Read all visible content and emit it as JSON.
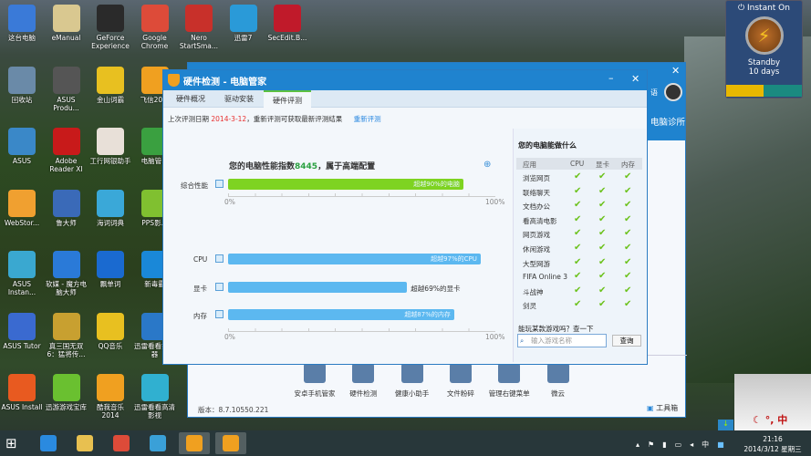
{
  "desktop_icons": [
    {
      "label": "这台电脑",
      "col": 0,
      "row": 0,
      "color": "#3a7ad8"
    },
    {
      "label": "eManual",
      "col": 1,
      "row": 0,
      "color": "#d9c890"
    },
    {
      "label": "GeForce Experience",
      "col": 2,
      "row": 0,
      "color": "#2a2a2a"
    },
    {
      "label": "Google Chrome",
      "col": 3,
      "row": 0,
      "color": "#dd4b39"
    },
    {
      "label": "Nero StartSma...",
      "col": 4,
      "row": 0,
      "color": "#c8302a"
    },
    {
      "label": "迅雷7",
      "col": 5,
      "row": 0,
      "color": "#2a9ad8"
    },
    {
      "label": "SecEdit.B...",
      "col": 6,
      "row": 0,
      "color": "#c01a2a"
    },
    {
      "label": "回收站",
      "col": 0,
      "row": 1,
      "color": "#6a8aa8"
    },
    {
      "label": "ASUS Produ...",
      "col": 1,
      "row": 1,
      "color": "#555"
    },
    {
      "label": "金山词霸",
      "col": 2,
      "row": 1,
      "color": "#e8c020"
    },
    {
      "label": "飞信20...",
      "col": 3,
      "row": 1,
      "color": "#f0a020"
    },
    {
      "label": "ASUS",
      "col": 0,
      "row": 2,
      "color": "#3a88c8"
    },
    {
      "label": "Adobe Reader XI",
      "col": 1,
      "row": 2,
      "color": "#c81a1a"
    },
    {
      "label": "工行网银助手",
      "col": 2,
      "row": 2,
      "color": "#e8e0d8"
    },
    {
      "label": "电脑管...",
      "col": 3,
      "row": 2,
      "color": "#3aa040"
    },
    {
      "label": "WebStor...",
      "col": 0,
      "row": 3,
      "color": "#f0a030"
    },
    {
      "label": "鲁大师",
      "col": 1,
      "row": 3,
      "color": "#3a6ab8"
    },
    {
      "label": "海词词典",
      "col": 2,
      "row": 3,
      "color": "#3aa8d8"
    },
    {
      "label": "PPS影...",
      "col": 3,
      "row": 3,
      "color": "#80c030"
    },
    {
      "label": "ASUS Instan...",
      "col": 0,
      "row": 4,
      "color": "#3aa8d0"
    },
    {
      "label": "软媒 - 魔方电脑大师",
      "col": 1,
      "row": 4,
      "color": "#2a7ad8"
    },
    {
      "label": "飘单词",
      "col": 2,
      "row": 4,
      "color": "#1a6ad0"
    },
    {
      "label": "新毒霸",
      "col": 3,
      "row": 4,
      "color": "#1a88d8"
    },
    {
      "label": "ASUS Tutor",
      "col": 0,
      "row": 5,
      "color": "#3a6ad0"
    },
    {
      "label": "真三国无双6：猛将传...",
      "col": 1,
      "row": 5,
      "color": "#c8a030"
    },
    {
      "label": "QQ音乐",
      "col": 2,
      "row": 5,
      "color": "#e8c020"
    },
    {
      "label": "迅雷看看播放器",
      "col": 3,
      "row": 5,
      "color": "#2a78c8"
    },
    {
      "label": "ASUS Install",
      "col": 0,
      "row": 6,
      "color": "#e85a20"
    },
    {
      "label": "迅游游戏宝库",
      "col": 1,
      "row": 6,
      "color": "#6ac030"
    },
    {
      "label": "酷我音乐2014",
      "col": 2,
      "row": 6,
      "color": "#f0a020"
    },
    {
      "label": "迅雷看看高清影视",
      "col": 3,
      "row": 6,
      "color": "#30b0d0"
    }
  ],
  "instant_on": {
    "title": "Instant On",
    "status": "Standby",
    "days": "10 days"
  },
  "back_window": {
    "right_text": "电脑诊所",
    "partial_text": "语",
    "version": "版本：8.7.10550.221",
    "toolbox": "工具箱",
    "tools": [
      "安卓手机管家",
      "硬件检测",
      "健康小助手",
      "文件粉碎",
      "管理右键菜单",
      "微云"
    ]
  },
  "window": {
    "title": "硬件检测 - 电脑管家",
    "tabs": [
      "硬件概况",
      "驱动安装",
      "硬件评测"
    ],
    "active_tab": 2,
    "date_prefix": "上次评测日期 ",
    "date": "2014-3-12",
    "date_suffix": "，重新评测可获取最新评测结果",
    "retest": "重新评测",
    "heading_prefix": "您的电脑性能指数",
    "score": "8445",
    "heading_suffix": "，属于高端配置",
    "axis_min": "0%",
    "axis_max": "100%",
    "overall": {
      "label": "综合性能",
      "value": 88,
      "text": "超越90%的电脑",
      "color": "#7ed321"
    },
    "components": [
      {
        "label": "CPU",
        "value": 94.5,
        "text": "超越97%的CPU",
        "inside": true
      },
      {
        "label": "显卡",
        "value": 67,
        "text": "超越69%的显卡",
        "inside": false
      },
      {
        "label": "内存",
        "value": 84.6,
        "text": "超越87%的内存",
        "inside": true
      }
    ],
    "bar_color": "#5cb8f0",
    "panel": {
      "title": "您的电脑能做什么",
      "headers": [
        "应用",
        "CPU",
        "显卡",
        "内存"
      ],
      "rows": [
        "浏览网页",
        "联络聊天",
        "文档办公",
        "看高清电影",
        "网页游戏",
        "休闲游戏",
        "大型网游",
        "FIFA Online 3",
        "斗战神",
        "剑灵"
      ],
      "query_label": "能玩某款游戏吗？查一下",
      "search_placeholder": "输入游戏名称",
      "search_button": "查询"
    }
  },
  "taskbar": {
    "time": "21:16",
    "date": "2014/3/12 星期三",
    "ime": "中",
    "float_ime": "中"
  }
}
